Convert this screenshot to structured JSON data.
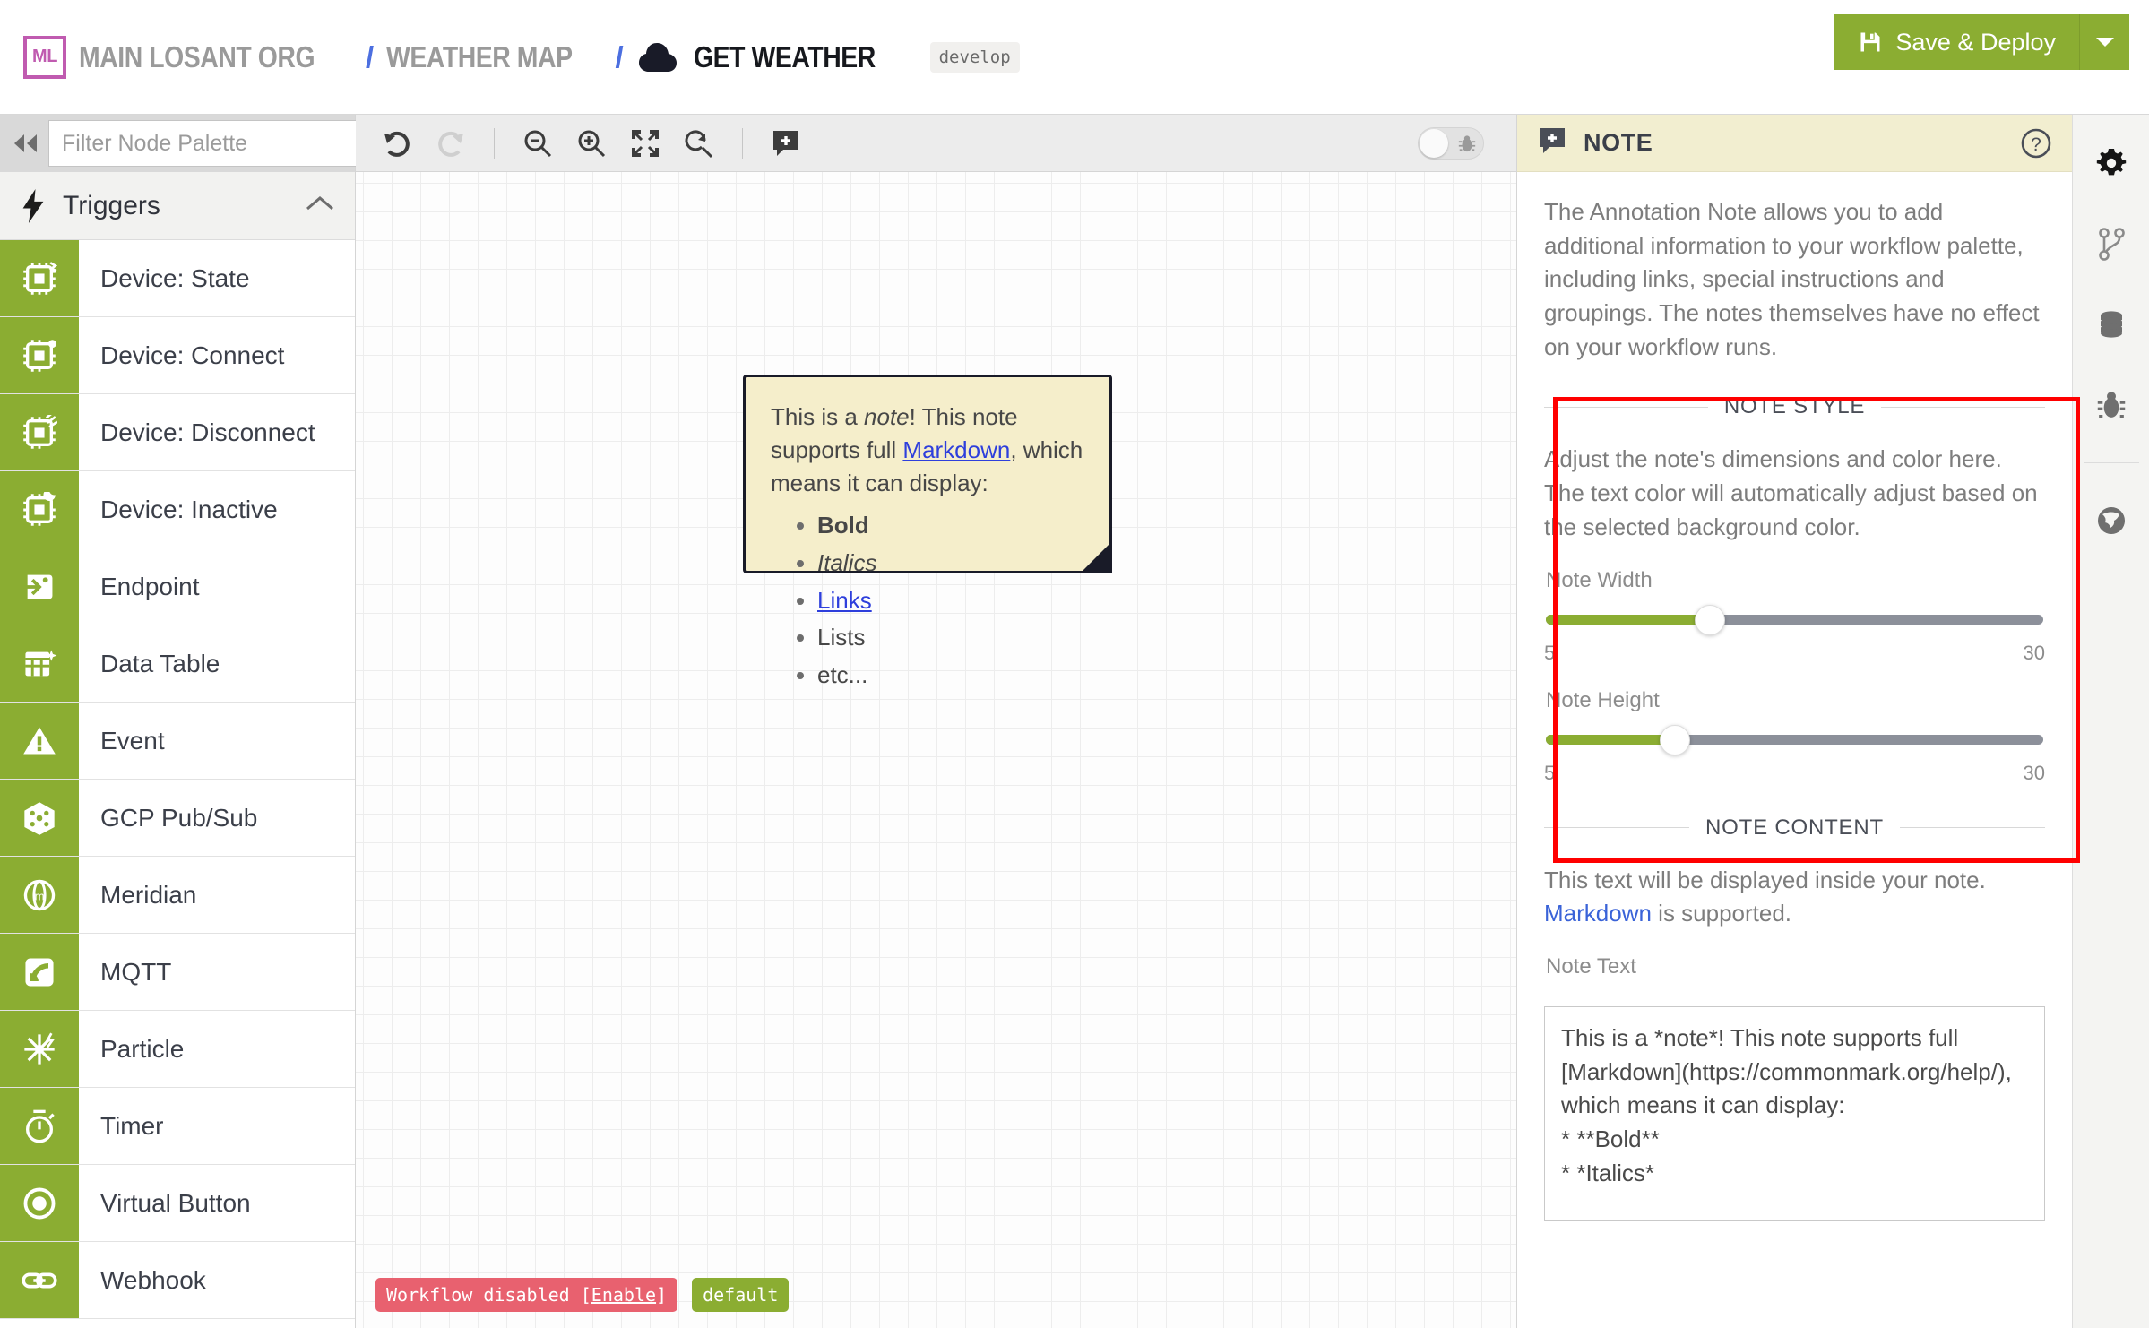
{
  "header": {
    "logo_text": "ML",
    "breadcrumb": [
      {
        "label": "MAIN LOSANT ORG",
        "active": false
      },
      {
        "label": "WEATHER MAP",
        "active": false
      },
      {
        "label": "GET WEATHER",
        "active": true
      }
    ],
    "separator": "/",
    "version_badge": "develop",
    "save_label": "Save & Deploy",
    "accent_green": "#8bad32",
    "logo_purple": "#c05bb0"
  },
  "palette": {
    "collapse_label": "◀◀",
    "filter_placeholder": "Filter Node Palette",
    "filter_value": "",
    "group": {
      "label": "Triggers",
      "expanded": true
    },
    "items": [
      {
        "label": "Device: State",
        "icon": "chip-state-icon"
      },
      {
        "label": "Device: Connect",
        "icon": "chip-connect-icon"
      },
      {
        "label": "Device: Disconnect",
        "icon": "chip-disconnect-icon"
      },
      {
        "label": "Device: Inactive",
        "icon": "chip-inactive-icon"
      },
      {
        "label": "Endpoint",
        "icon": "endpoint-icon"
      },
      {
        "label": "Data Table",
        "icon": "data-table-icon"
      },
      {
        "label": "Event",
        "icon": "event-warning-icon"
      },
      {
        "label": "GCP Pub/Sub",
        "icon": "gcp-pubsub-icon"
      },
      {
        "label": "Meridian",
        "icon": "meridian-icon"
      },
      {
        "label": "MQTT",
        "icon": "mqtt-icon"
      },
      {
        "label": "Particle",
        "icon": "particle-icon"
      },
      {
        "label": "Timer",
        "icon": "timer-icon"
      },
      {
        "label": "Virtual Button",
        "icon": "virtual-button-icon"
      },
      {
        "label": "Webhook",
        "icon": "webhook-link-icon"
      }
    ]
  },
  "toolbar": {
    "undo": "undo-icon",
    "redo": "redo-icon",
    "zoom_out": "zoom-out-icon",
    "zoom_in": "zoom-in-icon",
    "fit_screen": "fit-screen-icon",
    "reset_zoom": "reset-zoom-icon",
    "add_note": "add-note-icon",
    "debug_toggle": {
      "icon": "bug-icon",
      "on": false
    }
  },
  "canvas": {
    "note": {
      "line1_pre": "This is a ",
      "line1_em": "note",
      "line1_post": "! This note supports full ",
      "link_label": "Markdown",
      "line1_tail": ", which means it can display:",
      "bullets": [
        "Bold",
        "Italics",
        "Links",
        "Lists",
        "etc..."
      ]
    },
    "status": {
      "disabled_pre": "Workflow disabled ",
      "disabled_bracket_open": "[",
      "enable_label": "Enable",
      "disabled_bracket_close": "]",
      "version_label": "default"
    }
  },
  "inspector": {
    "header_title": "Note",
    "header_icon": "note-icon",
    "help_icon": "help-circle-icon",
    "description": "The Annotation Note allows you to add additional information to your workflow palette, including links, special instructions and groupings. The notes themselves have no effect on your workflow runs.",
    "style_section": {
      "title": "Note Style",
      "description": "Adjust the note's dimensions and color here. The text color will automatically adjust based on the selected background color.",
      "width": {
        "label": "Note Width",
        "min": "5",
        "max": "30",
        "percent": 33
      },
      "height": {
        "label": "Note Height",
        "min": "5",
        "max": "30",
        "percent": 26
      }
    },
    "content_section": {
      "title": "Note Content",
      "description_pre": "This text will be displayed inside your note. ",
      "description_link": "Markdown",
      "description_post": " is supported.",
      "textarea_label": "Note Text",
      "textarea_value": "This is a *note*! This note supports full [Markdown](https://commonmark.org/help/), which means it can display:\n* **Bold**\n* *Italics*"
    },
    "highlight_color": "#ff0000"
  },
  "rail": {
    "items": [
      {
        "icon": "gear-icon",
        "active": true
      },
      {
        "icon": "git-branch-icon",
        "active": false
      },
      {
        "icon": "database-icon",
        "active": false
      },
      {
        "icon": "bug-icon",
        "active": false
      },
      {
        "icon": "globe-icon",
        "active": false
      }
    ]
  }
}
